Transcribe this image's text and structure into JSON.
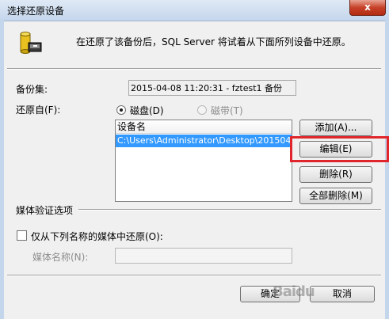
{
  "window": {
    "title": "选择还原设备",
    "close_label": "x"
  },
  "info": {
    "message": "在还原了该备份后，SQL Server 将试着从下面所列设备中还原。"
  },
  "backup_set": {
    "label": "备份集:",
    "value": "2015-04-08 11:20:31 - fztest1 备份"
  },
  "restore_from": {
    "label": "还原自(F):",
    "options": [
      {
        "label": "磁盘(D)",
        "checked": true,
        "disabled": false
      },
      {
        "label": "磁带(T)",
        "checked": false,
        "disabled": true
      }
    ]
  },
  "device_list": {
    "header": "设备名",
    "rows": [
      "C:\\Users\\Administrator\\Desktop\\2015040..."
    ]
  },
  "buttons": {
    "add": "添加(A)...",
    "edit": "编辑(E)",
    "remove": "删除(R)",
    "remove_all": "全部删除(M)",
    "ok": "确定",
    "cancel": "取消"
  },
  "media_options": {
    "section_label": "媒体验证选项",
    "checkbox_label": "仅从下列名称的媒体中还原(O):",
    "checkbox_checked": false,
    "media_name_label": "媒体名称(N):",
    "media_name_value": ""
  },
  "watermark": {
    "text": "Baidu"
  },
  "colors": {
    "highlight_box": "#e0262c",
    "selection": "#3399ff"
  }
}
